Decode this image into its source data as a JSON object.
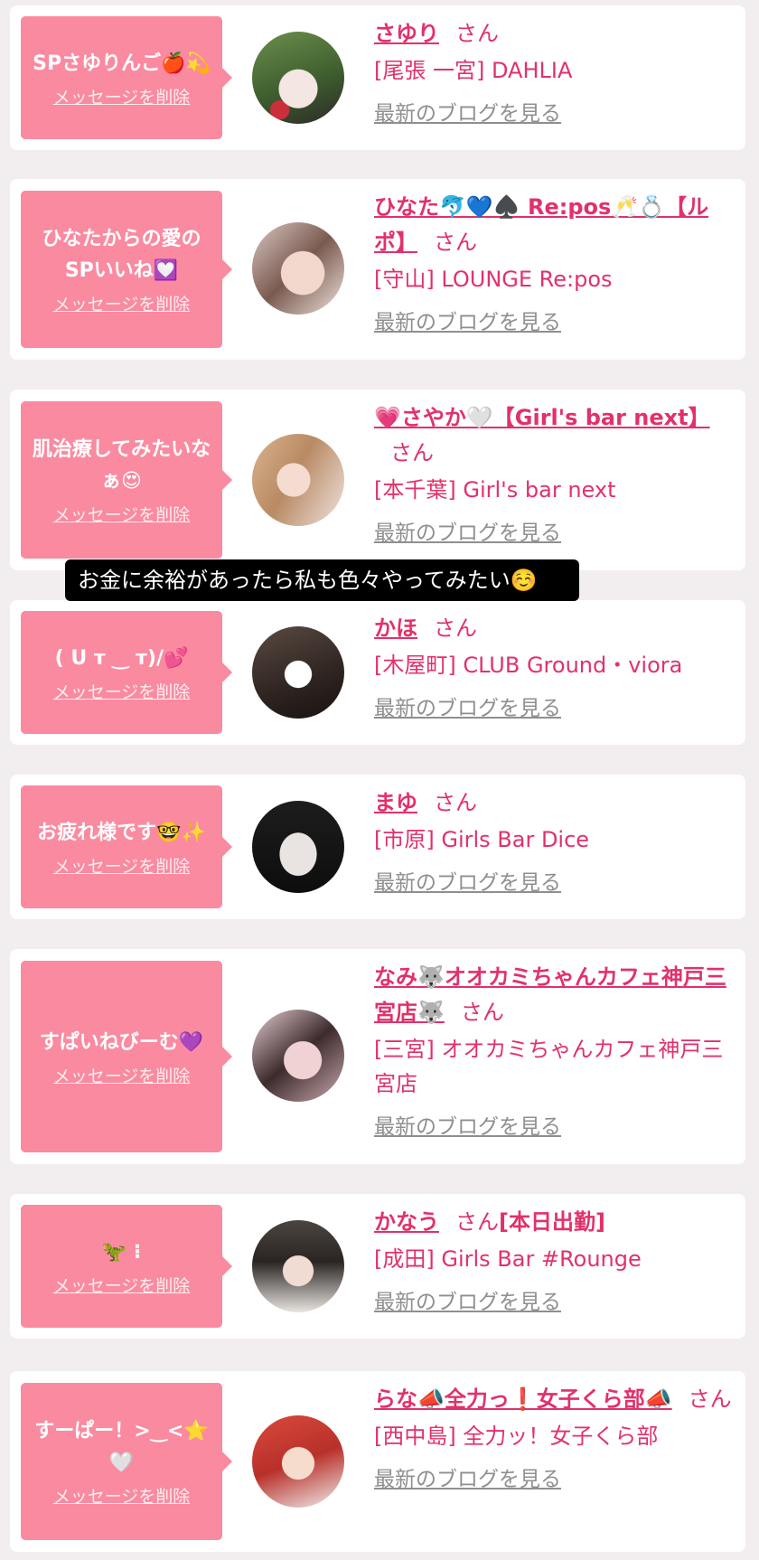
{
  "delete_label": "メッセージを削除",
  "san_label": "さん",
  "blog_link_label": "最新のブログを見る",
  "caption": "お金に余裕があったら私も色々やってみたい☺️",
  "cards": [
    {
      "message": "SPさゆりんご🍎💫",
      "name": "さゆり",
      "suffix": "",
      "shop": "[尾張 一宮] DAHLIA"
    },
    {
      "message": "ひなたからの愛のSPいいね💟",
      "name": "ひなた🐬💙♠️ Re:pos🥂💍【ルポ】",
      "suffix": "",
      "shop": "[守山] LOUNGE Re:pos"
    },
    {
      "message": "肌治療してみたいなぁ😍",
      "name": "💗さやか🤍【Girl's bar next】",
      "suffix": "",
      "shop": "[本千葉] Girl's bar next"
    },
    {
      "message": "( U ᴛ ‿ ᴛ)/💕",
      "name": "かほ",
      "suffix": "",
      "shop": "[木屋町] CLUB Ground・viora"
    },
    {
      "message": "お疲れ様です🤓✨",
      "name": "まゆ",
      "suffix": "",
      "shop": "[市原] Girls Bar Dice"
    },
    {
      "message": "すぱいねびーむ💜",
      "name": "なみ🐺オオカミちゃんカフェ神戸三宮店🐺",
      "suffix": "",
      "shop": "[三宮] オオカミちゃんカフェ神戸三宮店"
    },
    {
      "message": "🦖 ⁝",
      "name": "かなう",
      "suffix": "[本日出勤]",
      "shop": "[成田] Girls Bar #Rounge"
    },
    {
      "message": "すーぱー！>‿<⭐️🤍",
      "name": "らな📣全力っ❗️女子くら部📣",
      "suffix": "",
      "shop": "[西中島] 全力ッ！女子くら部"
    }
  ],
  "colors": {
    "accent": "#e2316a",
    "bubble": "#fa8aa0",
    "link_gray": "#8f8f8f",
    "background": "#f2eef0"
  }
}
